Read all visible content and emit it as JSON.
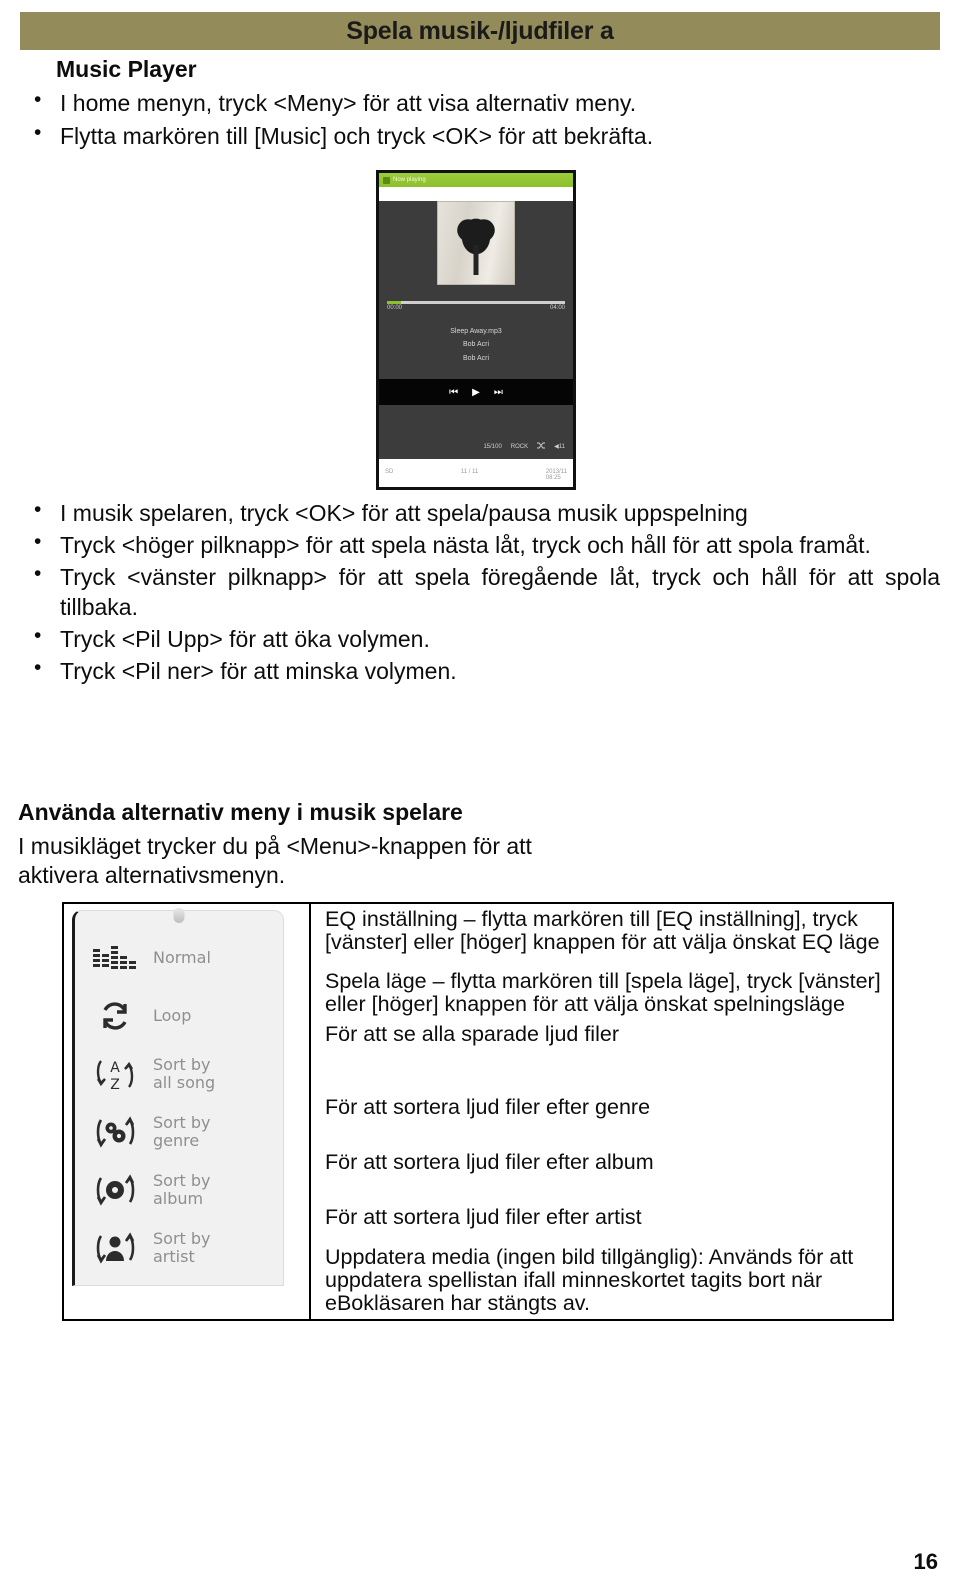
{
  "header": {
    "title": "Spela musik-/ljudfiler a",
    "band_color": "#938c5a"
  },
  "music_player_section": {
    "heading": "Music Player",
    "bullets": [
      "I home menyn, tryck <Meny> för att visa alternativ meny.",
      "Flytta markören till [Music] och tryck <OK> för att bekräfta."
    ]
  },
  "player_screenshot": {
    "now_playing_label": "Now playing",
    "time_elapsed": "00:00",
    "time_total": "04:00",
    "track_title": "Sleep Away.mp3",
    "artist": "Bob Acri",
    "album": "Bob Acri",
    "controls": {
      "previous": "⏮",
      "play": "▶",
      "next": "⏭"
    },
    "status": {
      "track_count": "15/100",
      "eq_mode": "ROCK",
      "shuffle_icon": "shuffle-icon",
      "volume": "11"
    },
    "bottom_bar": {
      "storage": "SD",
      "page_indicator": "11 / 11",
      "clock": "2013/11\n08:25"
    },
    "accent_green": "#8cc02c"
  },
  "playback_bullets": [
    "I musik spelaren, tryck <OK> för att spela/pausa musik uppspelning",
    "Tryck <höger pilknapp> för att spela nästa låt, tryck och håll för att spola framåt.",
    "Tryck <vänster pilknapp> för att spela föregående låt, tryck och håll för att spola tillbaka.",
    "Tryck <Pil Upp> för att öka volymen.",
    "Tryck <Pil ner> för att minska volymen."
  ],
  "alt_menu_section": {
    "heading": "Använda alternativ meny i musik spelare",
    "text": "I musikläget trycker du på <Menu>-knappen för att aktivera alternativsmenyn."
  },
  "options_menu": {
    "items": [
      {
        "icon": "equalizer-icon",
        "label": "Normal"
      },
      {
        "icon": "loop-icon",
        "label": "Loop"
      },
      {
        "icon": "sort-az-icon",
        "label": "Sort by\nall song"
      },
      {
        "icon": "sort-genre-icon",
        "label": "Sort by\ngenre"
      },
      {
        "icon": "sort-album-icon",
        "label": "Sort by\nalbum"
      },
      {
        "icon": "sort-artist-icon",
        "label": "Sort by\nartist"
      }
    ]
  },
  "options_descriptions": {
    "eq": "EQ inställning – flytta markören till [EQ inställning], tryck [vänster] eller [höger] knappen för att välja önskat EQ läge",
    "play_mode": "Spela läge – flytta markören till [spela läge], tryck [vänster] eller [höger] knappen för att välja önskat spelningsläge",
    "all_songs": "För att se alla sparade ljud filer",
    "genre": "För att sortera ljud filer efter genre",
    "album": "För att sortera ljud filer efter album",
    "artist": "För att sortera ljud filer efter artist",
    "update_media": "Uppdatera media (ingen bild tillgänglig): Används för att uppdatera spellistan ifall minneskortet tagits bort när eBokläsaren har stängts av."
  },
  "footer": {
    "page_number": "16"
  }
}
